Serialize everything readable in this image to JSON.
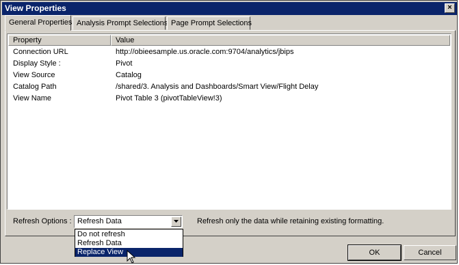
{
  "window": {
    "title": "View Properties",
    "close_glyph": "×"
  },
  "tabs": [
    {
      "label": "General Properties",
      "active": true
    },
    {
      "label": "Analysis Prompt Selections",
      "active": false
    },
    {
      "label": "Page Prompt Selections",
      "active": false
    }
  ],
  "grid": {
    "columns": [
      "Property",
      "Value"
    ],
    "rows": [
      {
        "property": "Connection URL",
        "value": "http://obieesample.us.oracle.com:9704/analytics/jbips"
      },
      {
        "property": "Display Style :",
        "value": "Pivot"
      },
      {
        "property": "View Source",
        "value": "Catalog"
      },
      {
        "property": "Catalog Path",
        "value": "/shared/3. Analysis and Dashboards/Smart View/Flight Delay"
      },
      {
        "property": "View Name",
        "value": "Pivot Table 3 (pivotTableView!3)"
      }
    ]
  },
  "refresh": {
    "label": "Refresh Options :",
    "selected": "Refresh Data",
    "description": "Refresh only the data while retaining existing formatting.",
    "options": [
      "Do not refresh",
      "Refresh Data",
      "Replace View"
    ],
    "highlighted_option": "Replace View"
  },
  "buttons": {
    "ok": "OK",
    "cancel": "Cancel"
  },
  "colors": {
    "titlebar": "#0a246a",
    "face": "#d4d0c8",
    "selection": "#0a246a"
  }
}
